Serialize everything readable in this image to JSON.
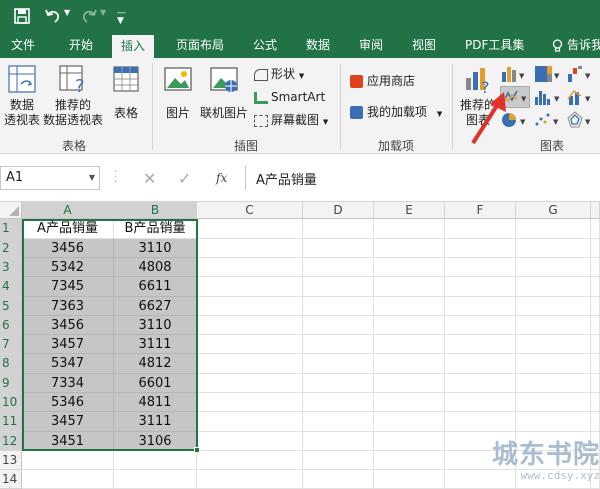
{
  "titlebar": {
    "icons": [
      "save-icon",
      "undo-icon",
      "redo-icon",
      "customize-qat-icon"
    ]
  },
  "tabs": [
    "文件",
    "开始",
    "插入",
    "页面布局",
    "公式",
    "数据",
    "审阅",
    "视图",
    "PDF工具集",
    "告诉我"
  ],
  "ribbon": {
    "groups": {
      "tables": "表格",
      "illustrations": "插图",
      "addins": "加载项",
      "charts": "图表"
    },
    "buttons": {
      "pivot": "数据\n透视表",
      "rec_pivot": "推荐的\n数据透视表",
      "table": "表格",
      "picture": "图片",
      "online_picture": "联机图片",
      "shapes": "形状",
      "smartart": "SmartArt",
      "screenshot": "屏幕截图",
      "store": "应用商店",
      "my_addins": "我的加载项",
      "rec_charts": "推荐的\n图表"
    }
  },
  "formula_bar": {
    "name_box": "A1",
    "fx": "fx",
    "content": "A产品销量"
  },
  "sheet": {
    "columns": [
      "A",
      "B",
      "C",
      "D",
      "E",
      "F",
      "G"
    ],
    "rows": [
      [
        "A产品销量",
        "B产品销量"
      ],
      [
        "3456",
        "3110"
      ],
      [
        "5342",
        "4808"
      ],
      [
        "7345",
        "6611"
      ],
      [
        "7363",
        "6627"
      ],
      [
        "3456",
        "3110"
      ],
      [
        "3457",
        "3111"
      ],
      [
        "5347",
        "4812"
      ],
      [
        "7334",
        "6601"
      ],
      [
        "5346",
        "4811"
      ],
      [
        "3457",
        "3111"
      ],
      [
        "3451",
        "3106"
      ],
      [
        "",
        ""
      ],
      [
        "",
        ""
      ]
    ]
  },
  "watermark": {
    "main": "城东书院",
    "sub": "www.cdsy.xyz"
  },
  "colors": {
    "brand": "#217346",
    "selection": "#c6c6c6",
    "arrow": "#e0312c"
  }
}
